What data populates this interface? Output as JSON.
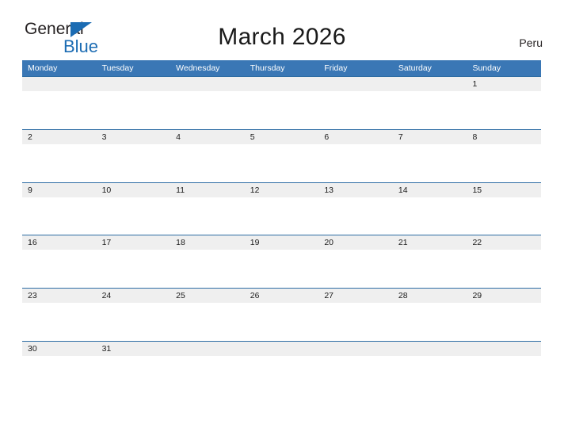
{
  "branding": {
    "word_one": "General",
    "word_two": "Blue",
    "triangle_icon": "triangle-right-icon",
    "accent_color": "#1c6cb3"
  },
  "header": {
    "title": "March 2026",
    "country": "Peru"
  },
  "colors": {
    "header_blue": "#3a77b5",
    "row_border_blue": "#2e6da4",
    "date_band_gray": "#efefef",
    "text_dark": "#1a1a1a"
  },
  "calendar": {
    "weekdays": [
      "Monday",
      "Tuesday",
      "Wednesday",
      "Thursday",
      "Friday",
      "Saturday",
      "Sunday"
    ],
    "weeks": [
      [
        "",
        "",
        "",
        "",
        "",
        "",
        "1"
      ],
      [
        "2",
        "3",
        "4",
        "5",
        "6",
        "7",
        "8"
      ],
      [
        "9",
        "10",
        "11",
        "12",
        "13",
        "14",
        "15"
      ],
      [
        "16",
        "17",
        "18",
        "19",
        "20",
        "21",
        "22"
      ],
      [
        "23",
        "24",
        "25",
        "26",
        "27",
        "28",
        "29"
      ],
      [
        "30",
        "31",
        "",
        "",
        "",
        "",
        ""
      ]
    ]
  }
}
